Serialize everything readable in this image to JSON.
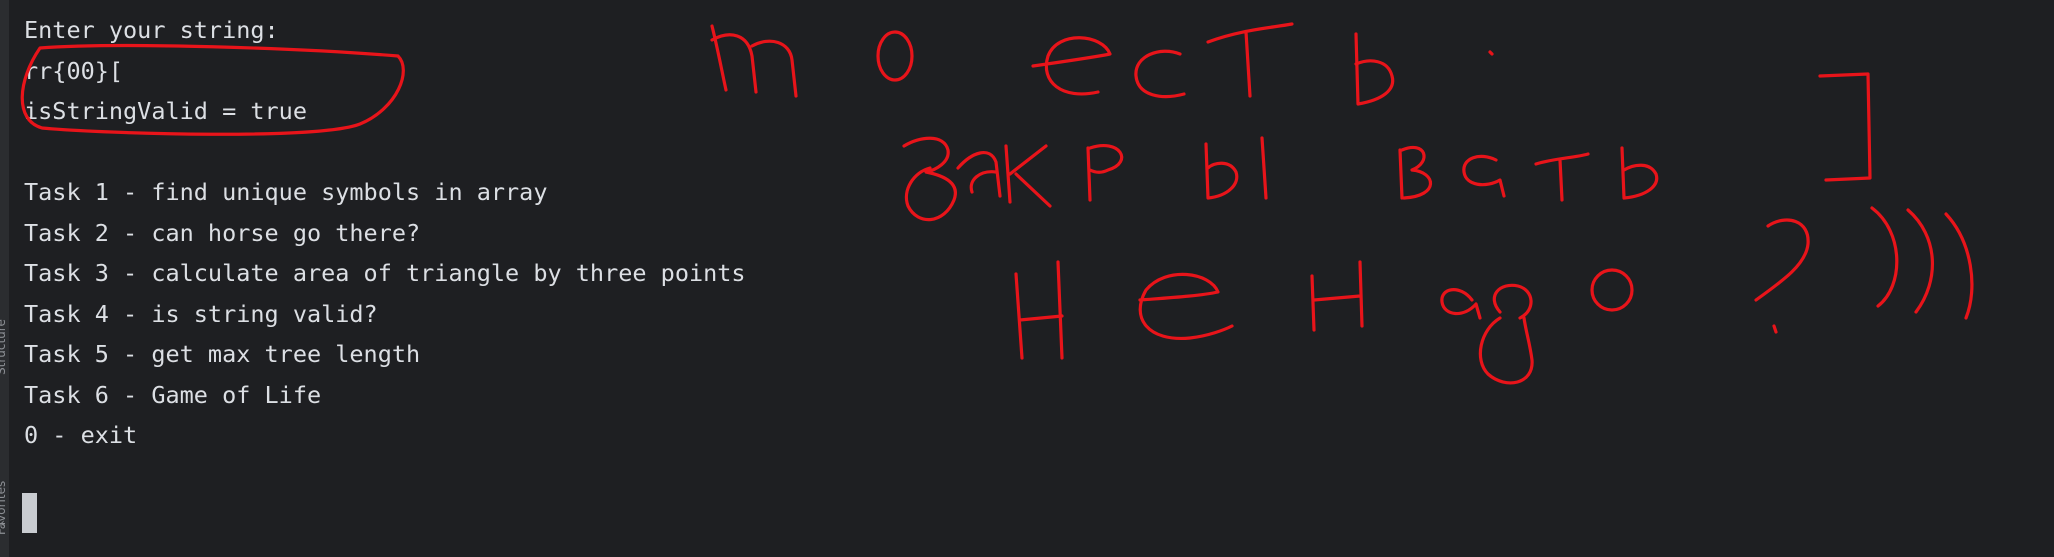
{
  "terminal": {
    "lines": [
      "Enter your string:",
      "rr{00}[",
      "isStringValid = true",
      "",
      "Task 1 - find unique symbols in array",
      "Task 2 - can horse go there?",
      "Task 3 - calculate area of triangle by three points",
      "Task 4 - is string valid?",
      "Task 5 - get max tree length",
      "Task 6 - Game of Life",
      "0 - exit"
    ]
  },
  "sidebar": {
    "tab_top": "Structure",
    "tab_bottom": "Favorites",
    "arrow": "‹"
  },
  "annotation": {
    "color": "#e8141a",
    "handwriting": [
      "то есть",
      "закрывать ]",
      "не надо ?)))"
    ]
  }
}
